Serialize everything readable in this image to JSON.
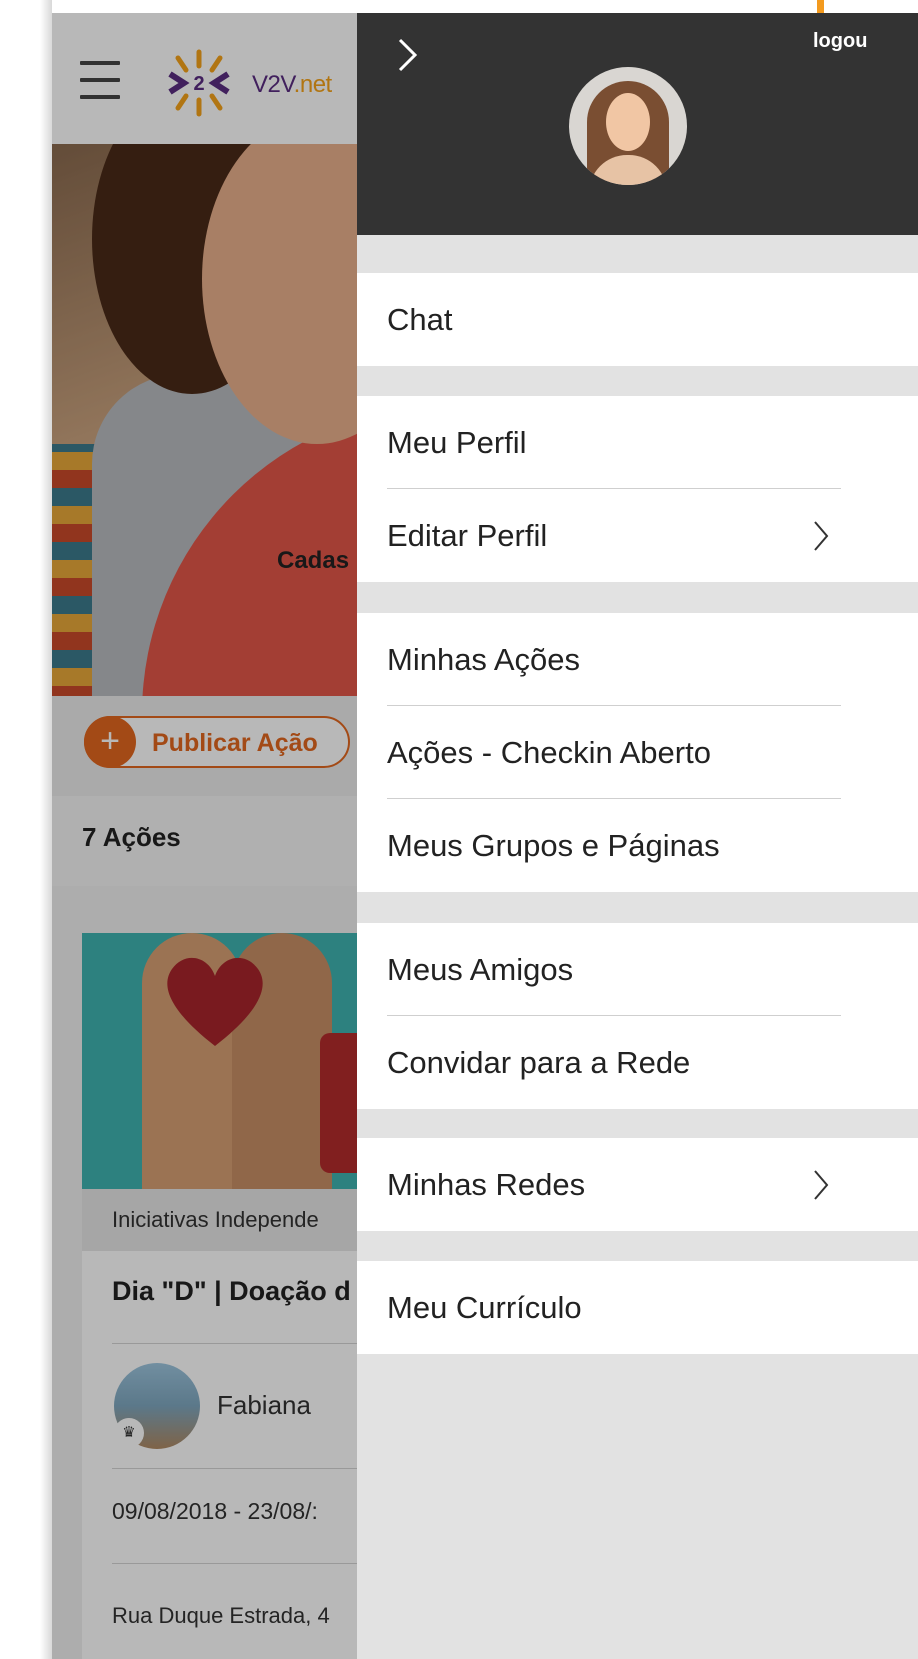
{
  "app": {
    "logo_text": "V2V",
    "logo_suffix": ".net",
    "hero_caption": "Cadas",
    "publish_label": "Publicar Ação",
    "actions_count": "7 Ações",
    "card": {
      "category": "Iniciativas Independe",
      "title": "Dia \"D\" | Doação d",
      "author": "Fabiana",
      "date": "09/08/2018 - 23/08/:",
      "address": "Rua Duque Estrada, 4"
    }
  },
  "drawer": {
    "logout_label": "logou",
    "groups": [
      {
        "items": [
          {
            "label": "Chat",
            "chevron": false
          }
        ]
      },
      {
        "items": [
          {
            "label": "Meu Perfil",
            "chevron": false
          },
          {
            "label": "Editar Perfil",
            "chevron": true
          }
        ]
      },
      {
        "items": [
          {
            "label": "Minhas Ações",
            "chevron": false
          },
          {
            "label": "Ações - Checkin Aberto",
            "chevron": false
          },
          {
            "label": "Meus Grupos e Páginas",
            "chevron": false
          }
        ]
      },
      {
        "items": [
          {
            "label": "Meus Amigos",
            "chevron": false
          },
          {
            "label": "Convidar para a Rede",
            "chevron": false
          }
        ]
      },
      {
        "items": [
          {
            "label": "Minhas Redes",
            "chevron": true
          }
        ]
      },
      {
        "items": [
          {
            "label": "Meu Currículo",
            "chevron": false
          }
        ]
      }
    ]
  },
  "colors": {
    "accent": "#e2671f",
    "drawer_header": "#333333",
    "brand_purple": "#5a2d82",
    "brand_orange": "#f5a31a"
  }
}
